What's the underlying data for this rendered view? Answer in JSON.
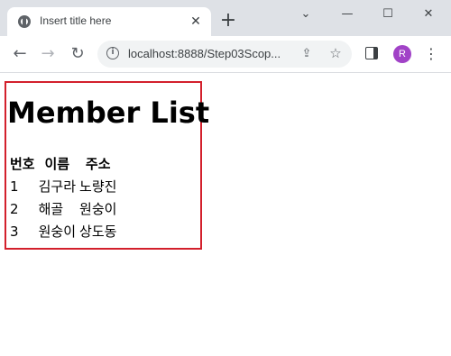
{
  "browser": {
    "tab": {
      "title": "Insert title here"
    },
    "address_bar": {
      "url": "localhost:8888/Step03Scop..."
    },
    "profile": {
      "initial": "R",
      "color": "#a142c7"
    },
    "icons": {
      "favicon": "globe-icon",
      "tab_close": "close-icon",
      "new_tab": "plus-icon",
      "back": "back-arrow-icon",
      "forward": "forward-arrow-icon",
      "reload": "reload-icon",
      "site_info": "info-icon",
      "share": "share-icon",
      "bookmark": "star-icon",
      "side_panel": "side-panel-icon",
      "menu": "kebab-menu-icon",
      "minimize": "minimize-icon",
      "maximize": "maximize-icon",
      "window_close": "window-close-icon",
      "tab_search": "chevron-down-icon"
    }
  },
  "page": {
    "heading": "Member List",
    "highlight_color": "#d3202c",
    "table": {
      "headers": [
        "번호",
        "이름",
        "주소"
      ],
      "rows": [
        [
          "1",
          "김구라",
          "노량진"
        ],
        [
          "2",
          "해골",
          "원숭이"
        ],
        [
          "3",
          "원숭이",
          "상도동"
        ]
      ]
    }
  }
}
